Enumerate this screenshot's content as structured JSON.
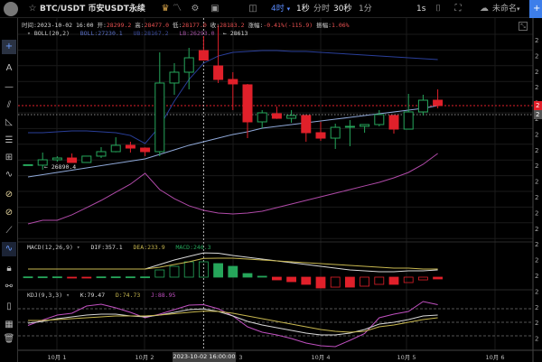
{
  "header": {
    "symbol": "BTC/USDT",
    "market": "币安USDT永续",
    "intervals": [
      {
        "label": "4时",
        "active": true
      },
      {
        "label": "1秒"
      },
      {
        "label": "分时"
      },
      {
        "label": "30秒"
      },
      {
        "label": "1分"
      }
    ],
    "interval_suffix": "▾",
    "speed": "1s",
    "layout_name": "未命名",
    "layout_caret": "▾",
    "plus": "+"
  },
  "icons": {
    "top": [
      "logo-icon",
      "star-icon",
      "search-icon",
      "crown-icon",
      "indicator-icon",
      "gear-icon",
      "template-icon",
      "layout-icon",
      "camera-icon",
      "fullscreen-icon",
      "cloud-icon"
    ],
    "sidebar": [
      "crosshair-icon",
      "text-icon",
      "line-icon",
      "parallel-line-icon",
      "triangle-icon",
      "horizontal-lines-icon",
      "grid-icon",
      "wave-icon",
      "magnet-icon",
      "magnet-strong-icon",
      "ruler-icon",
      "brush-icon",
      "lock-icon",
      "visibility-icon",
      "bookmark-icon",
      "calendar-icon",
      "trash-icon"
    ]
  },
  "ohlc_bar": {
    "time_label": "时间:",
    "time": "2023-10-02 16:00",
    "open_label": "开:",
    "open": "28299.2",
    "high_label": "高:",
    "high": "28477.0",
    "low_label": "低:",
    "low": "28177.0",
    "close_label": "收:",
    "close": "28183.2",
    "change_label": "涨幅:",
    "change": "-0.41%(-115.9)",
    "amp_label": "振幅:",
    "amp": "1.06%"
  },
  "boll": {
    "title": "BOLL(20,2)",
    "mid": "BOLL:27230.1",
    "ub": "UB:28167.2",
    "lb": "LB:26293.0",
    "max_marker": "← 28613",
    "min_marker": "← 26890.4"
  },
  "macd": {
    "title": "MACD(12,26,9)",
    "dif": "DIF:357.1",
    "dea": "DEA:233.9",
    "macd": "MACD:246.3"
  },
  "kdj": {
    "title": "KDJ(9,3,3)",
    "k": "K:79.47",
    "d": "D:74.73",
    "j": "J:88.95"
  },
  "caret": "▾",
  "x_axis": {
    "ticks": [
      "10月 1",
      "10月 2",
      "10月 3",
      "10月 4",
      "10月 5",
      "10月 6"
    ],
    "crosshair_label": "2023-10-02 16:00:00"
  },
  "price_axis": {
    "last_price_label": "2",
    "mark_label": "2",
    "tick_label": "2"
  },
  "colors": {
    "up": "#26a65b",
    "down": "#e0202a",
    "boll_mid": "#8fa8d8",
    "boll_ub": "#2a3f9a",
    "boll_lb": "#b04aa8",
    "dif": "#d8d8d8",
    "dea": "#c8b850",
    "kdj_k": "#d8d8d8",
    "kdj_d": "#c8b850",
    "kdj_j": "#c050c0",
    "accent": "#3d7eea"
  },
  "chart_data": {
    "type": "candlestick",
    "crosshair_index": 12,
    "last_price": 27624,
    "mark_price": 27513,
    "candles": [
      [
        26895,
        26900,
        26890,
        26898
      ],
      [
        26892,
        27047,
        26836,
        26958
      ],
      [
        26958,
        27002,
        26936,
        26980
      ],
      [
        26980,
        27036,
        26920,
        26925
      ],
      [
        26925,
        27005,
        26920,
        27003
      ],
      [
        27003,
        27113,
        26980,
        27058
      ],
      [
        27058,
        27235,
        27050,
        27136
      ],
      [
        27136,
        27180,
        27047,
        27102
      ],
      [
        27102,
        27110,
        27003,
        27058
      ],
      [
        27058,
        28278,
        27003,
        27901
      ],
      [
        27901,
        28145,
        27757,
        28034
      ],
      [
        28034,
        28333,
        27823,
        28211
      ],
      [
        28299.2,
        28477,
        28177,
        28183.2
      ],
      [
        28111,
        28613,
        27901,
        27945
      ],
      [
        27945,
        28034,
        27568,
        27890
      ],
      [
        27879,
        27890,
        27224,
        27424
      ],
      [
        27424,
        27568,
        27346,
        27535
      ],
      [
        27524,
        27612,
        27460,
        27468
      ],
      [
        27468,
        27568,
        27413,
        27502
      ],
      [
        27502,
        27510,
        27180,
        27291
      ],
      [
        27291,
        27424,
        27191,
        27224
      ],
      [
        27224,
        27402,
        27091,
        27357
      ],
      [
        27365,
        27446,
        27125,
        27369
      ],
      [
        27369,
        27395,
        27291,
        27391
      ],
      [
        27391,
        27568,
        27369,
        27513
      ],
      [
        27502,
        27510,
        27280,
        27335
      ],
      [
        27335,
        27768,
        27330,
        27546
      ],
      [
        27546,
        27757,
        27502,
        27690
      ],
      [
        27690,
        27823,
        27590,
        27624
      ]
    ],
    "boll_ub": [
      27291,
      27291,
      27302,
      27313,
      27313,
      27302,
      27291,
      27257,
      27158,
      27368,
      27679,
      27945,
      28145,
      28233,
      28278,
      28289,
      28300,
      28300,
      28289,
      28289,
      28278,
      28267,
      28256,
      28245,
      28233,
      28222,
      28211,
      28200,
      28189
    ],
    "boll_mid": [
      26747,
      26775,
      26803,
      26830,
      26858,
      26886,
      26914,
      26941,
      26969,
      27025,
      27080,
      27136,
      27180,
      27224,
      27269,
      27302,
      27346,
      27368,
      27391,
      27413,
      27435,
      27457,
      27479,
      27502,
      27524,
      27546,
      27568,
      27590,
      27624
    ],
    "boll_lb": [
      26171,
      26215,
      26215,
      26282,
      26370,
      26459,
      26559,
      26659,
      26792,
      26592,
      26481,
      26393,
      26337,
      26304,
      26293,
      26304,
      26326,
      26370,
      26415,
      26459,
      26503,
      26548,
      26592,
      26637,
      26681,
      26736,
      26803,
      26903,
      27036
    ],
    "macd_hist": [
      5,
      5,
      5,
      -5,
      -5,
      5,
      5,
      5,
      5,
      116,
      174,
      246,
      246.3,
      218,
      174,
      58,
      15,
      -44,
      -73,
      -116,
      -174,
      -160,
      -160,
      -145,
      -116,
      -116,
      -87,
      -44,
      -29
    ],
    "dif": [
      0,
      0,
      0,
      0,
      0,
      0,
      0,
      0,
      0,
      100,
      200,
      280,
      357.1,
      350,
      300,
      260,
      220,
      180,
      140,
      100,
      60,
      20,
      -20,
      -40,
      -60,
      -60,
      -40,
      -40,
      -20
    ],
    "dea": [
      0,
      0,
      0,
      0,
      0,
      0,
      0,
      0,
      0,
      40,
      100,
      160,
      233.9,
      240,
      240,
      220,
      200,
      180,
      160,
      140,
      120,
      100,
      80,
      60,
      40,
      20,
      20,
      0,
      0
    ],
    "k": [
      48,
      52,
      58,
      62,
      66,
      68,
      68,
      64,
      62,
      66,
      72,
      78,
      79.47,
      74,
      64,
      52,
      44,
      38,
      32,
      26,
      22,
      22,
      26,
      34,
      46,
      50,
      56,
      64,
      66
    ],
    "d": [
      54,
      54,
      56,
      58,
      60,
      62,
      64,
      64,
      64,
      66,
      69,
      72,
      74.73,
      74,
      70,
      64,
      58,
      52,
      46,
      40,
      34,
      30,
      28,
      30,
      40,
      44,
      50,
      56,
      60
    ],
    "j": [
      43,
      55,
      66,
      70,
      86,
      90,
      82,
      72,
      60,
      68,
      78,
      88,
      88.95,
      80,
      64,
      40,
      28,
      22,
      14,
      4,
      -2,
      -4,
      10,
      25,
      60,
      68,
      74,
      96,
      89
    ],
    "kdj_levels": [
      80,
      50,
      20
    ]
  }
}
